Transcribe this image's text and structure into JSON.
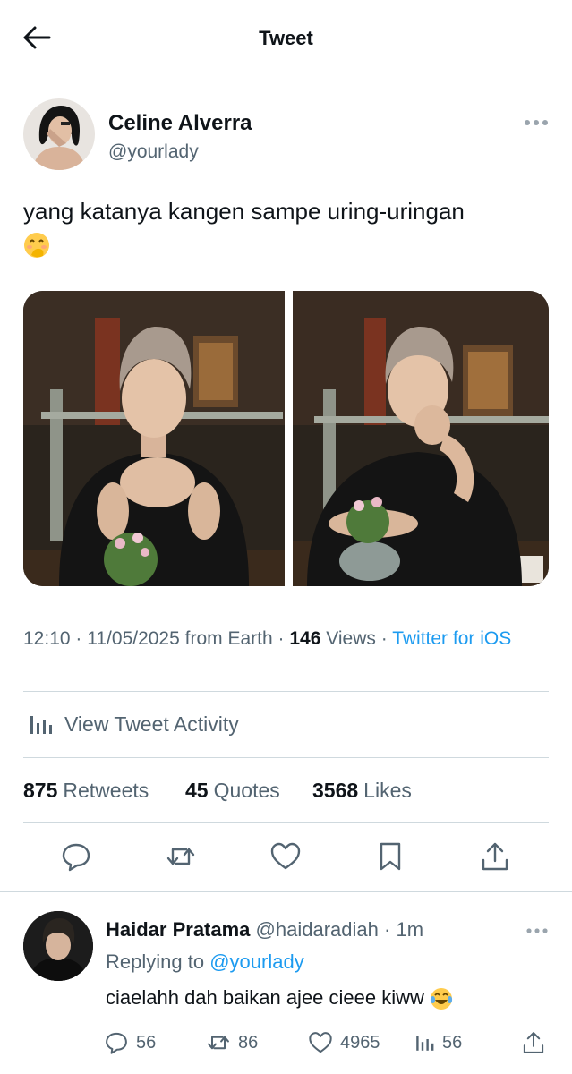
{
  "header": {
    "title": "Tweet",
    "back_icon": "arrow-left-icon"
  },
  "author": {
    "name": "Celine Alverra",
    "handle": "@yourlady",
    "avatar": "avatar-woman-photo"
  },
  "tweet": {
    "text": "yang katanya kangen sampe uring-uringan",
    "emoji": "face-with-hand-over-mouth",
    "photos": [
      "photo-man-hands-clasped",
      "photo-man-hand-on-chin"
    ]
  },
  "meta": {
    "time": "12:10",
    "date": "11/05/2025",
    "location": "from Earth",
    "views_count": "146",
    "views_label": "Views",
    "source": "Twitter for iOS"
  },
  "activity": {
    "label": "View Tweet Activity",
    "icon": "bar-chart-icon"
  },
  "stats": {
    "retweets_count": "875",
    "retweets_label": "Retweets",
    "quotes_count": "45",
    "quotes_label": "Quotes",
    "likes_count": "3568",
    "likes_label": "Likes"
  },
  "actions": [
    "reply-icon",
    "retweet-icon",
    "like-icon",
    "bookmark-icon",
    "share-icon"
  ],
  "reply": {
    "name": "Haidar Pratama",
    "handle": "@haidaradiah",
    "time": "1m",
    "replying_label": "Replying to",
    "replying_to": "@yourlady",
    "text": "ciaelahh dah baikan ajee cieee kiww",
    "emoji": "face-with-tears-of-joy",
    "replies": "56",
    "retweets": "86",
    "likes": "4965",
    "views": "56"
  },
  "colors": {
    "accent": "#1d9bf0",
    "text": "#0f1419",
    "muted": "#536471",
    "divider": "#cfd9de"
  }
}
